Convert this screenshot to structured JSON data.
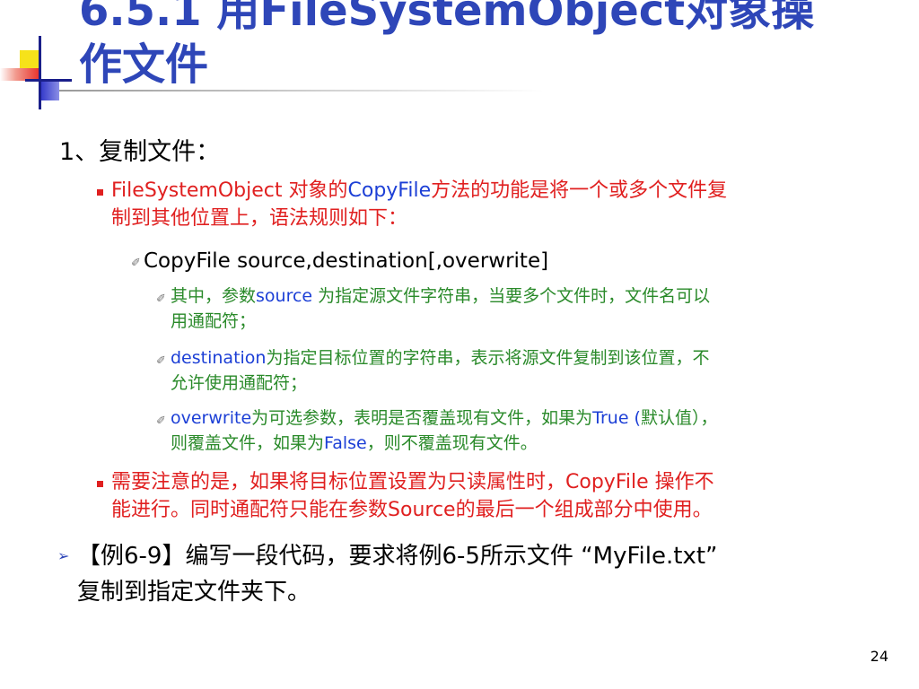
{
  "slide": {
    "title_line1": "6.5.1 用FileSystemObject对象操",
    "title_line2": "作文件",
    "heading": "1、复制文件：",
    "para1": {
      "a": "FileSystemObject 对象的",
      "b": "CopyFile",
      "c": "方法的功能是将一个或多个文件复",
      "line2": "制到其他位置上，语法规则如下："
    },
    "syntax": "CopyFile source,destination[,overwrite]",
    "source_item": {
      "a": "其中，参数",
      "b": "source",
      "c": " 为指定源文件字符串，当要多个文件时，文件名可以",
      "line2": "用通配符；"
    },
    "dest_item": {
      "a": "destination",
      "b": "为指定目标位置的字符串，表示将源文件复制到该位置，不",
      "line2": "允许使用通配符；"
    },
    "overwrite_item": {
      "a": "overwrite",
      "b": "为可选参数，表明是否覆盖现有文件，如果为",
      "c": "True (",
      "d": "默认值），",
      "line2a": "则覆盖文件，如果为",
      "line2b": "False",
      "line2c": "，则不覆盖现有文件。"
    },
    "para2": {
      "a": "需要注意的是，如果将目标位置设置为只读属性时，",
      "b": "CopyFile",
      "c": " 操作不",
      "line2a": "能进行。同时通配符只能在参数",
      "line2b": "Source",
      "line2c": "的最后一个组成部分中使用。"
    },
    "example": {
      "line1": "【例6-9】编写一段代码，要求将例6-5所示文件 “MyFile.txt”",
      "line2": "复制到指定文件夹下。"
    },
    "page_number": "24"
  },
  "colors": {
    "title": "#2e46b8",
    "red_text": "#e02020",
    "blue_text": "#1c3fd6",
    "green_text": "#2a8a2a"
  },
  "icons": [
    "square-bullet-icon",
    "triangle-bullet-icon",
    "pen-bullet-icon",
    "corner-logo"
  ]
}
